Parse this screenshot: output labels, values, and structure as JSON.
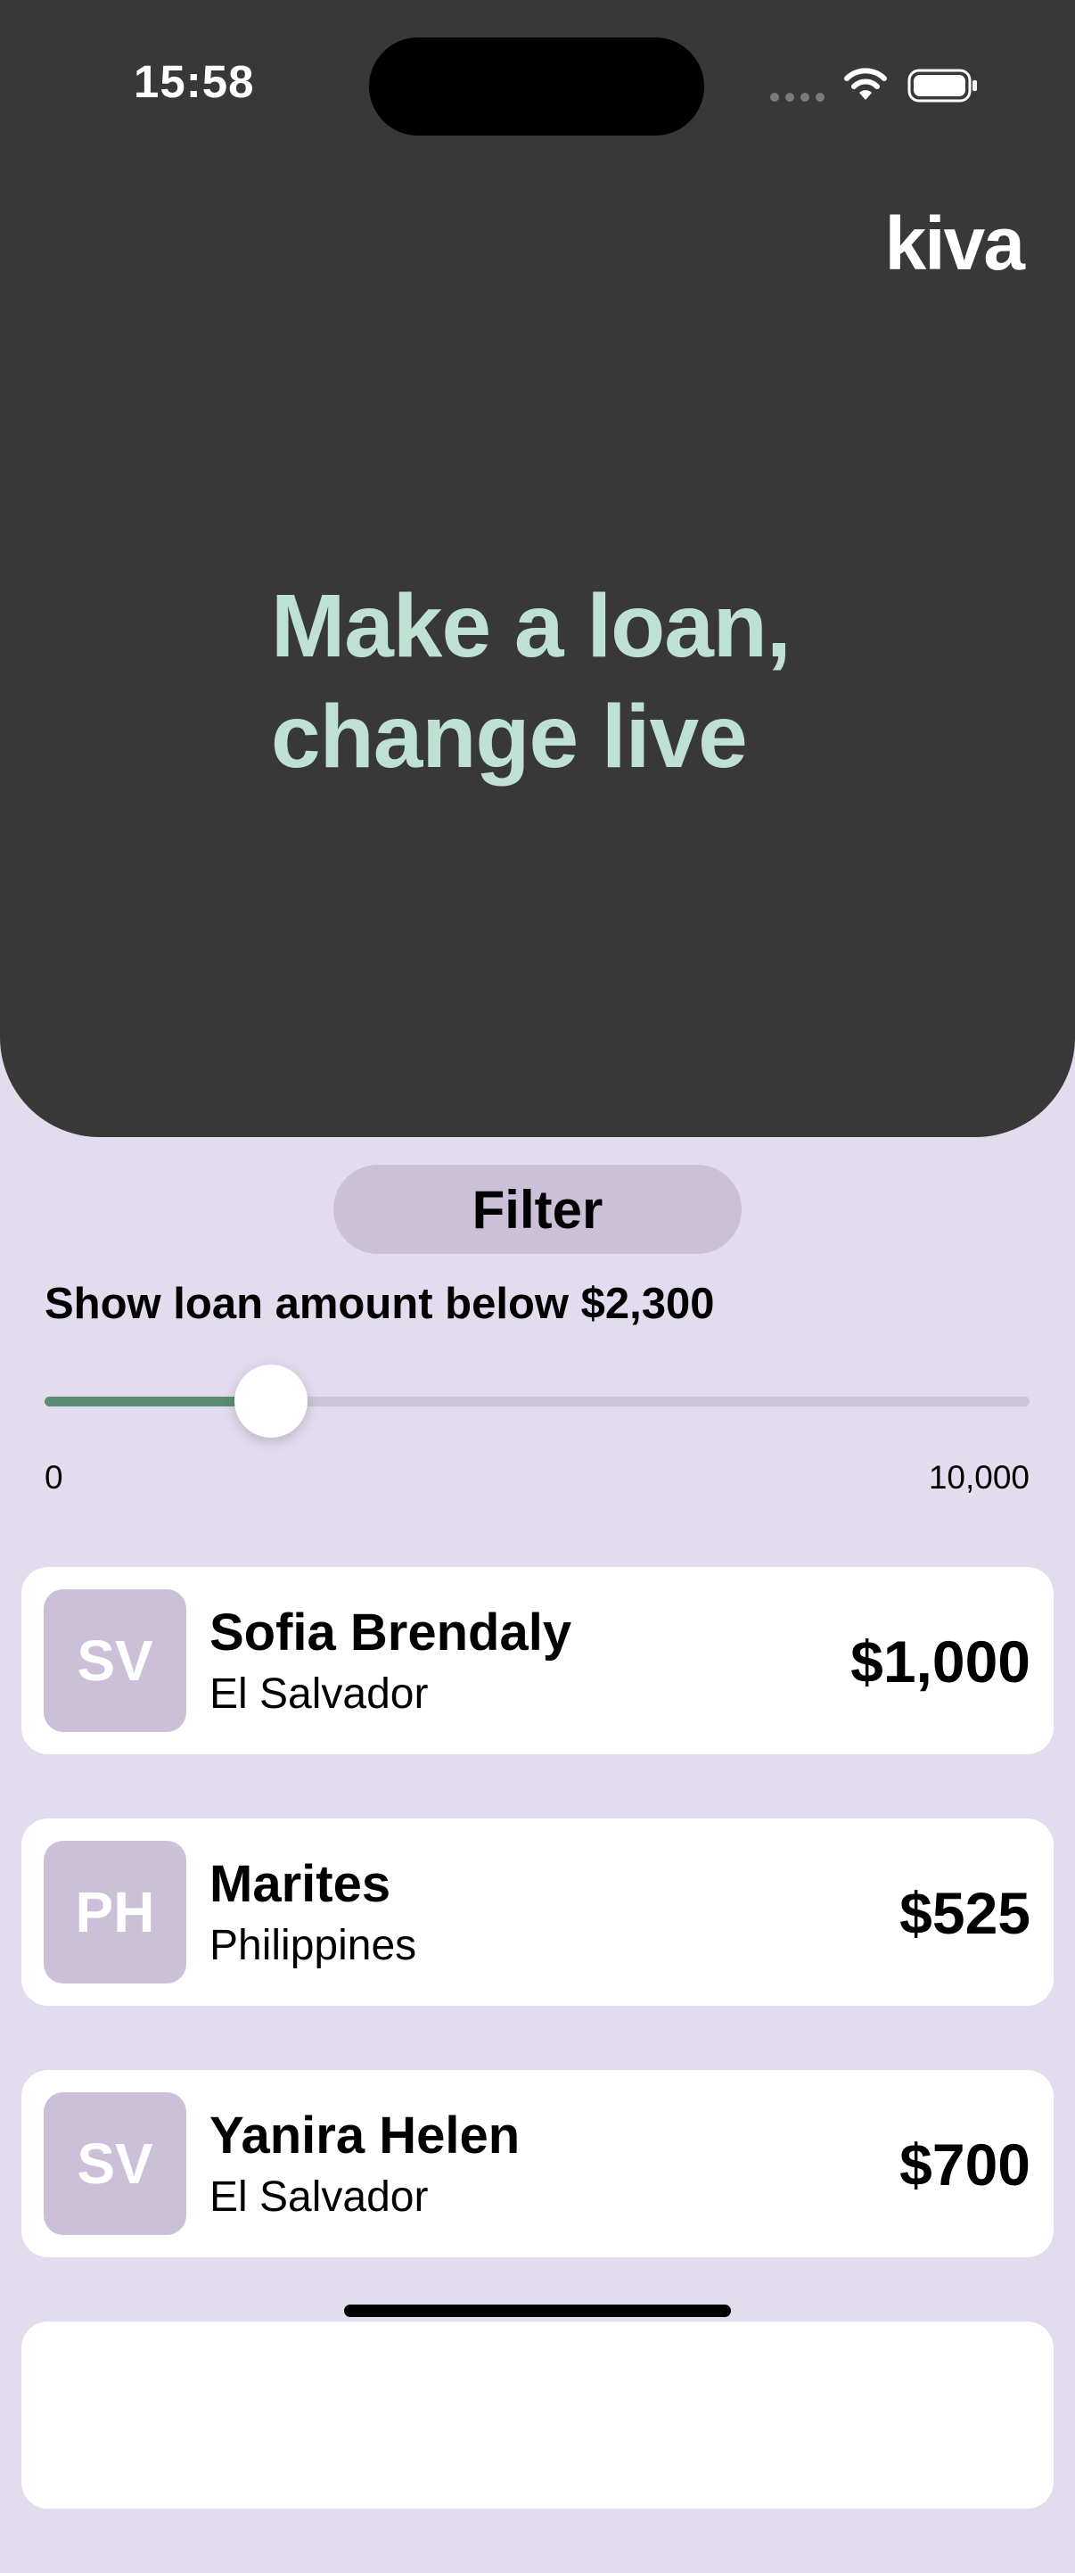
{
  "status_bar": {
    "time": "15:58",
    "icons": [
      "signal-dots-icon",
      "wifi-icon",
      "battery-icon"
    ]
  },
  "hero": {
    "logo": "kiva",
    "title_line1": "Make a loan,",
    "title_line2": "change live"
  },
  "filter": {
    "button_label": "Filter",
    "caption": "Show loan amount below $2,300",
    "slider": {
      "min_label": "0",
      "max_label": "10,000",
      "min": 0,
      "max": 10000,
      "value": 2300
    }
  },
  "loans": [
    {
      "initials": "SV",
      "name": "Sofia Brendaly",
      "country": "El Salvador",
      "amount": "$1,000"
    },
    {
      "initials": "PH",
      "name": "Marites",
      "country": "Philippines",
      "amount": "$525"
    },
    {
      "initials": "SV",
      "name": "Yanira Helen",
      "country": "El Salvador",
      "amount": "$700"
    }
  ],
  "colors": {
    "background": "#e3dbee",
    "hero_background": "#383838",
    "hero_title": "#bfe1d3",
    "accent_chip": "#ccc0d9",
    "slider_fill": "#5a8c76",
    "slider_track": "#cdc6d6",
    "card": "#ffffff"
  }
}
